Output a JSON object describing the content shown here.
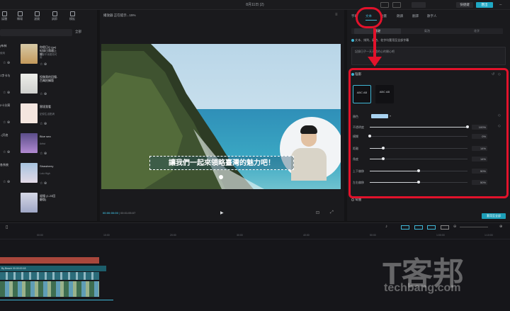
{
  "topbar": {
    "title": "8月11日 (2)",
    "shortcut_label": "快捷鍵",
    "export_label": "匯出"
  },
  "left": {
    "tools": [
      {
        "label": "媒體",
        "icon": "media-icon"
      },
      {
        "label": "轉場",
        "icon": "transition-icon"
      },
      {
        "label": "濾鏡",
        "icon": "filter-icon"
      },
      {
        "label": "調節",
        "icon": "adjust-icon"
      },
      {
        "label": "模板",
        "icon": "template-icon"
      }
    ],
    "filter_label": "全部",
    "cards": [
      {
        "name": "你假日Q (go)紀錄日落隨上線",
        "sub": "全部不用更改可用"
      },
      {
        "name": "投稿我的回憶- 百萬拍攝版",
        "sub": ""
      },
      {
        "name": "實境我看",
        "sub": "記錄生活點滴"
      },
      {
        "name": "Blue sea",
        "sub": "Artist"
      },
      {
        "name": "Strawberry",
        "sub": "Lulu High"
      },
      {
        "name": "留憶 (1.23回顧版)",
        "sub": ""
      }
    ],
    "left_cards": [
      {
        "name": "(布林",
        "sub": "使用"
      },
      {
        "name": "1字卡与",
        "sub": ""
      },
      {
        "name": "2十分齊",
        "sub": ""
      },
      {
        "name": ". (开启",
        "sub": ""
      },
      {
        "name": "各系統",
        "sub": ""
      }
    ]
  },
  "player": {
    "title": "播放器 正在提示...15%",
    "subtitle": "讓我們一起來領略臺灣的魅力吧！",
    "time_current": "00:00:00:00",
    "time_total": "00:01:05:07"
  },
  "right": {
    "tabs": [
      "字幕",
      "文本",
      "動畫",
      "朗讀",
      "翻譯",
      "數字人"
    ],
    "subtabs": [
      "基礎",
      "氣泡",
      "花字"
    ],
    "bulk_label": "文本、排列、氣泡、花字均套用至全部字幕",
    "text_box_value": "記錄日子一天天遠的心的開心吧",
    "shadow_label": "陰影",
    "presets": [
      "ABC AB",
      "ABC AB"
    ],
    "color_label": "顏色",
    "props": [
      {
        "label": "不透明度",
        "value": "100%",
        "fill": 1.0
      },
      {
        "label": "模糊",
        "value": "0%",
        "fill": 0.0
      },
      {
        "label": "距離",
        "value": "14%",
        "fill": 0.14
      },
      {
        "label": "角度",
        "value": "14%",
        "fill": 0.14
      },
      {
        "label": "上下偏移",
        "value": "50%",
        "fill": 0.5
      },
      {
        "label": "左右偏移",
        "value": "50%",
        "fill": 0.5
      }
    ],
    "curve_label": "彎曲",
    "apply_label": "套用至全部"
  },
  "timeline": {
    "ticks": [
      "00:00",
      "10:00",
      "20:00",
      "30:00",
      "40:00",
      "50:00",
      "1:00:00",
      "1:10:00",
      "1:20:00",
      "1:30:00"
    ],
    "audio_label": "By Beach 00:00:00:18"
  },
  "watermark": {
    "brand": "T客邦",
    "site": "techbang.com"
  },
  "colors": {
    "accent": "#3fb7d6",
    "annotation": "#e2122b",
    "apply": "#1d9fb8"
  }
}
